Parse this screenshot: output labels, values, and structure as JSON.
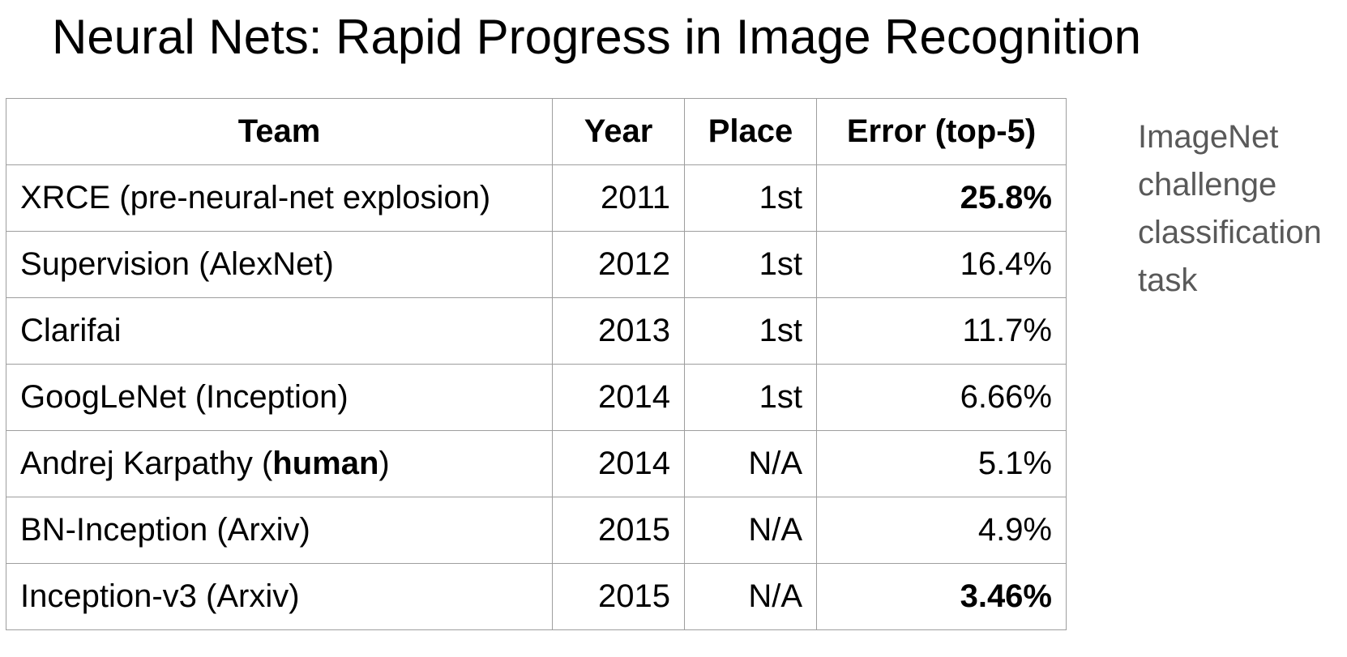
{
  "title": "Neural Nets: Rapid Progress in Image Recognition",
  "table": {
    "headers": [
      "Team",
      "Year",
      "Place",
      "Error (top-5)"
    ],
    "rows": [
      {
        "team": "XRCE (pre-neural-net explosion)",
        "year": "2011",
        "place": "1st",
        "error": "25.8%"
      },
      {
        "team": "Supervision (AlexNet)",
        "year": "2012",
        "place": "1st",
        "error": "16.4%"
      },
      {
        "team": "Clarifai",
        "year": "2013",
        "place": "1st",
        "error": "11.7%"
      },
      {
        "team": "GoogLeNet (Inception)",
        "year": "2014",
        "place": "1st",
        "error": "6.66%"
      },
      {
        "team_prefix": "Andrej Karpathy (",
        "team_bold": "human",
        "team_suffix": ")",
        "year": "2014",
        "place": "N/A",
        "error": "5.1%"
      },
      {
        "team": "BN-Inception (Arxiv)",
        "year": "2015",
        "place": "N/A",
        "error": "4.9%"
      },
      {
        "team": "Inception-v3 (Arxiv)",
        "year": "2015",
        "place": "N/A",
        "error": "3.46%"
      }
    ]
  },
  "side_note": {
    "lines": [
      "ImageNet",
      "challenge",
      "classification",
      "task"
    ]
  },
  "colors": {
    "title_text": "#000000",
    "border": "#9e9e9e",
    "side_note_text": "#595959"
  }
}
